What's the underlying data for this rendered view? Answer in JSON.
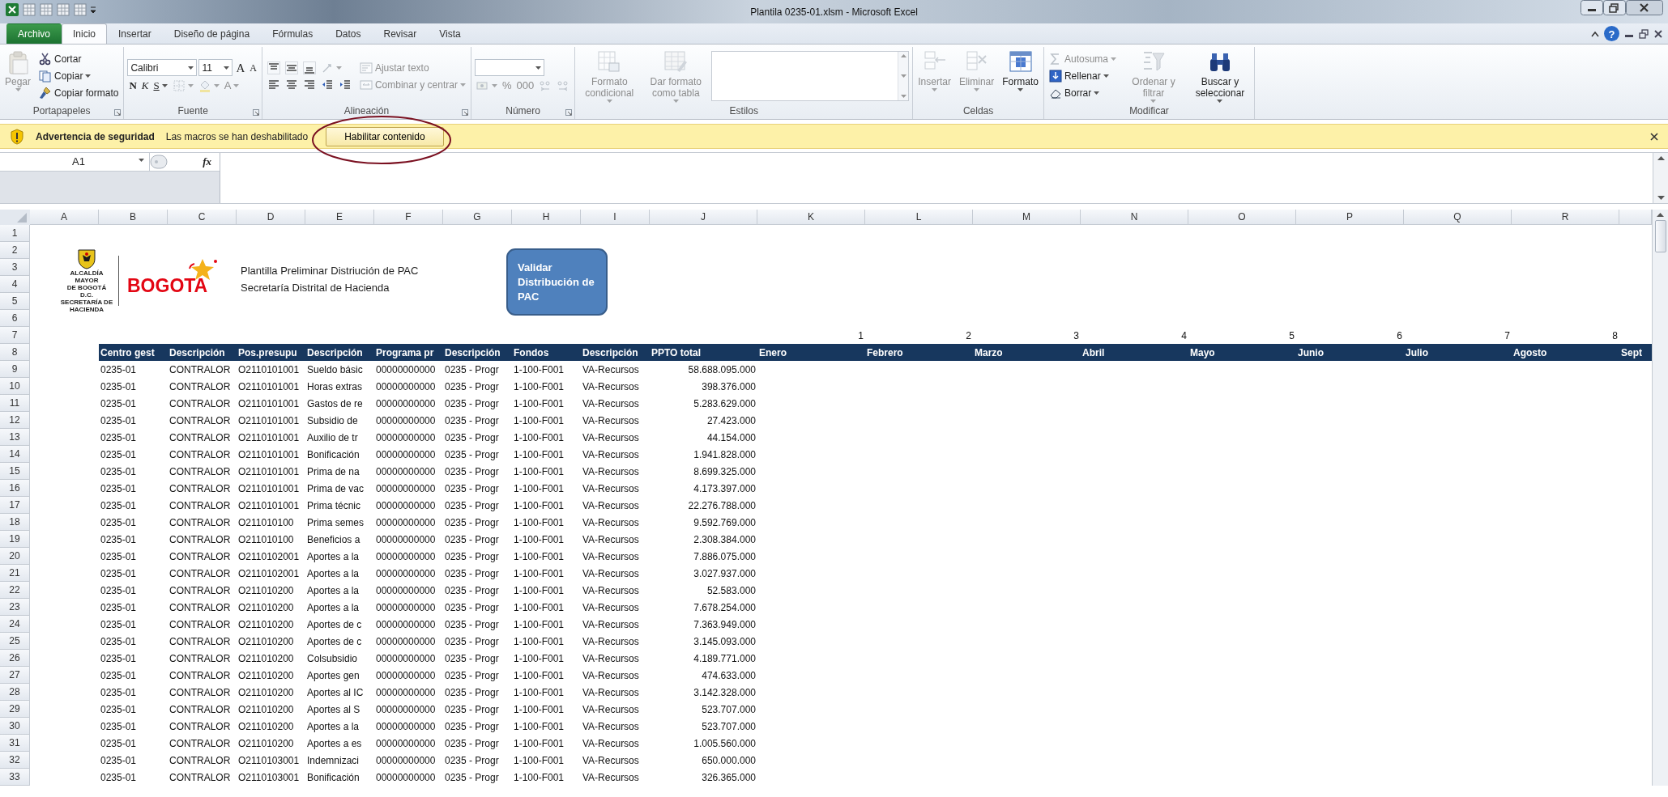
{
  "window": {
    "title": "Plantila 0235-01.xlsm  -  Microsoft Excel",
    "help": "?"
  },
  "tabs": [
    {
      "label": "Archivo",
      "kind": "file",
      "selected": false
    },
    {
      "label": "Inicio",
      "kind": "tab",
      "selected": true
    },
    {
      "label": "Insertar",
      "kind": "tab",
      "selected": false
    },
    {
      "label": "Diseño de página",
      "kind": "tab",
      "selected": false
    },
    {
      "label": "Fórmulas",
      "kind": "tab",
      "selected": false
    },
    {
      "label": "Datos",
      "kind": "tab",
      "selected": false
    },
    {
      "label": "Revisar",
      "kind": "tab",
      "selected": false
    },
    {
      "label": "Vista",
      "kind": "tab",
      "selected": false
    }
  ],
  "ribbon": [
    {
      "label": "Portapapeles",
      "launcher": true,
      "sections": [
        [
          [
            {
              "kind": "large",
              "label": "Pegar",
              "disabled": true,
              "dropdown": true
            }
          ]
        ],
        [
          [
            {
              "kind": "small",
              "label": "Cortar",
              "disabled": false
            }
          ],
          [
            {
              "kind": "small",
              "label": "Copiar",
              "disabled": false,
              "dropdown": true
            }
          ],
          [
            {
              "kind": "small",
              "label": "Copiar formato",
              "disabled": false
            }
          ]
        ]
      ]
    },
    {
      "label": "Fuente",
      "launcher": true,
      "sections": [
        [
          [
            {
              "kind": "wide-combo",
              "value": "Calibri"
            },
            {
              "kind": "combo",
              "value": "11"
            },
            {
              "kind": "grow",
              "label": "A",
              "disabled": false
            },
            {
              "kind": "shrink",
              "label": "A",
              "disabled": false
            }
          ],
          [
            {
              "kind": "bold",
              "label": "N",
              "disabled": false
            },
            {
              "kind": "italic",
              "label": "K",
              "disabled": false
            },
            {
              "kind": "underline",
              "label": "S",
              "disabled": false,
              "dropdown": true
            },
            {
              "kind": "icon",
              "disabled": true,
              "dropdown": true
            },
            {
              "kind": "icon",
              "disabled": true,
              "dropdown": true
            },
            {
              "kind": "glyph",
              "label": "A",
              "disabled": true,
              "dropdown": true
            }
          ]
        ]
      ]
    },
    {
      "label": "Alineación",
      "launcher": true,
      "sections": [
        [
          [
            {
              "kind": "icon",
              "disabled": false
            },
            {
              "kind": "icon",
              "disabled": false
            },
            {
              "kind": "icon",
              "disabled": false
            },
            {
              "kind": "icon",
              "disabled": true,
              "dropdown": true
            }
          ],
          [
            {
              "kind": "icon",
              "disabled": false
            },
            {
              "kind": "icon",
              "disabled": false
            },
            {
              "kind": "icon",
              "disabled": false
            },
            {
              "kind": "icon",
              "disabled": false
            },
            {
              "kind": "icon",
              "disabled": false
            }
          ]
        ],
        [
          [
            {
              "kind": "small",
              "label": "Ajustar texto",
              "disabled": true
            }
          ],
          [
            {
              "kind": "small",
              "label": "Combinar y centrar",
              "disabled": true,
              "dropdown": true
            }
          ]
        ]
      ]
    },
    {
      "label": "Número",
      "launcher": true,
      "sections": [
        [
          [
            {
              "kind": "wide-combo"
            }
          ],
          [
            {
              "kind": "icon",
              "disabled": true,
              "dropdown": true
            },
            {
              "kind": "glyph",
              "label": "%",
              "disabled": true
            },
            {
              "kind": "glyph",
              "label": "000",
              "disabled": true
            },
            {
              "kind": "icon",
              "disabled": true
            },
            {
              "kind": "icon",
              "disabled": true
            }
          ]
        ]
      ]
    },
    {
      "label": "Estilos",
      "launcher": false,
      "sections": [
        [
          [
            {
              "kind": "large",
              "label": "Formato condicional",
              "disabled": true,
              "dropdown": true
            }
          ]
        ],
        [
          [
            {
              "kind": "large",
              "label": "Dar formato como tabla",
              "disabled": true,
              "dropdown": true
            }
          ]
        ],
        [
          [
            {
              "kind": "gallery"
            }
          ]
        ]
      ]
    },
    {
      "label": "Celdas",
      "launcher": false,
      "sections": [
        [
          [
            {
              "kind": "large",
              "label": "Insertar",
              "disabled": true,
              "dropdown": true
            }
          ]
        ],
        [
          [
            {
              "kind": "large",
              "label": "Eliminar",
              "disabled": true,
              "dropdown": true
            }
          ]
        ],
        [
          [
            {
              "kind": "large",
              "label": "Formato",
              "disabled": false,
              "dropdown": true
            }
          ]
        ]
      ]
    },
    {
      "label": "Modificar",
      "launcher": false,
      "sections": [
        [
          [
            {
              "kind": "small",
              "label": "Autosuma",
              "disabled": true,
              "dropdown": true
            }
          ],
          [
            {
              "kind": "small",
              "label": "Rellenar",
              "disabled": false,
              "dropdown": true
            }
          ],
          [
            {
              "kind": "small",
              "label": "Borrar",
              "disabled": false,
              "dropdown": true
            }
          ]
        ],
        [
          [
            {
              "kind": "large",
              "label": "Ordenar y filtrar",
              "disabled": true,
              "dropdown": true
            }
          ]
        ],
        [
          [
            {
              "kind": "large",
              "label": "Buscar y seleccionar",
              "disabled": false,
              "dropdown": true
            }
          ]
        ]
      ]
    }
  ],
  "security_bar": {
    "title": "Advertencia de seguridad",
    "message": "Las macros se han deshabilitado",
    "button": "Habilitar contenido"
  },
  "formula_bar": {
    "name_box": "A1",
    "function_label": "fx"
  },
  "sheet": {
    "column_headers": [
      "A",
      "B",
      "C",
      "D",
      "E",
      "F",
      "G",
      "H",
      "I",
      "J",
      "K",
      "L",
      "M",
      "N",
      "O",
      "P",
      "Q",
      "R"
    ],
    "row_numbers": [
      "1",
      "2",
      "3",
      "4",
      "5",
      "6",
      "7",
      "8",
      "9",
      "10",
      "11",
      "12",
      "13",
      "14",
      "15",
      "16",
      "17",
      "18",
      "19",
      "20",
      "21",
      "22",
      "23",
      "24",
      "25",
      "26",
      "27",
      "28",
      "29",
      "30",
      "31",
      "32",
      "33"
    ],
    "logo": {
      "lines": [
        "ALCALDÍA MAYOR",
        "DE BOGOTÁ D.C.",
        "SECRETARÍA DE HACIENDA"
      ],
      "wordmark": "BOGOTA"
    },
    "title_lines": [
      "Plantilla Preliminar Distriución de PAC",
      "Secretaría Distrital de Hacienda"
    ],
    "macro_button": "Validar Distribución de PAC",
    "month_numbers": [
      "1",
      "2",
      "3",
      "4",
      "5",
      "6",
      "7",
      "8"
    ],
    "table": {
      "columns": [
        "Centro gest",
        "Descripción",
        "Pos.presupu",
        "Descripción",
        "Programa pr",
        "Descripción",
        "Fondos",
        "Descripción",
        "PPTO total",
        "Enero",
        "Febrero",
        "Marzo",
        "Abril",
        "Mayo",
        "Junio",
        "Julio",
        "Agosto",
        "Sept"
      ],
      "rows": [
        [
          "0235-01",
          "CONTRALOR",
          "O2110101001",
          "Sueldo básic",
          "00000000000",
          "0235 - Progr",
          "1-100-F001",
          "VA-Recursos",
          "58.688.095.000"
        ],
        [
          "0235-01",
          "CONTRALOR",
          "O2110101001",
          "Horas extras",
          "00000000000",
          "0235 - Progr",
          "1-100-F001",
          "VA-Recursos",
          "398.376.000"
        ],
        [
          "0235-01",
          "CONTRALOR",
          "O2110101001",
          "Gastos de re",
          "00000000000",
          "0235 - Progr",
          "1-100-F001",
          "VA-Recursos",
          "5.283.629.000"
        ],
        [
          "0235-01",
          "CONTRALOR",
          "O2110101001",
          "Subsidio de",
          "00000000000",
          "0235 - Progr",
          "1-100-F001",
          "VA-Recursos",
          "27.423.000"
        ],
        [
          "0235-01",
          "CONTRALOR",
          "O2110101001",
          "Auxilio de tr",
          "00000000000",
          "0235 - Progr",
          "1-100-F001",
          "VA-Recursos",
          "44.154.000"
        ],
        [
          "0235-01",
          "CONTRALOR",
          "O2110101001",
          "Bonificación",
          "00000000000",
          "0235 - Progr",
          "1-100-F001",
          "VA-Recursos",
          "1.941.828.000"
        ],
        [
          "0235-01",
          "CONTRALOR",
          "O2110101001",
          "Prima de na",
          "00000000000",
          "0235 - Progr",
          "1-100-F001",
          "VA-Recursos",
          "8.699.325.000"
        ],
        [
          "0235-01",
          "CONTRALOR",
          "O2110101001",
          "Prima de vac",
          "00000000000",
          "0235 - Progr",
          "1-100-F001",
          "VA-Recursos",
          "4.173.397.000"
        ],
        [
          "0235-01",
          "CONTRALOR",
          "O2110101001",
          "Prima técnic",
          "00000000000",
          "0235 - Progr",
          "1-100-F001",
          "VA-Recursos",
          "22.276.788.000"
        ],
        [
          "0235-01",
          "CONTRALOR",
          "O211010100",
          "Prima semes",
          "00000000000",
          "0235 - Progr",
          "1-100-F001",
          "VA-Recursos",
          "9.592.769.000"
        ],
        [
          "0235-01",
          "CONTRALOR",
          "O211010100",
          "Beneficios a",
          "00000000000",
          "0235 - Progr",
          "1-100-F001",
          "VA-Recursos",
          "2.308.384.000"
        ],
        [
          "0235-01",
          "CONTRALOR",
          "O2110102001",
          "Aportes a la",
          "00000000000",
          "0235 - Progr",
          "1-100-F001",
          "VA-Recursos",
          "7.886.075.000"
        ],
        [
          "0235-01",
          "CONTRALOR",
          "O2110102001",
          "Aportes a la",
          "00000000000",
          "0235 - Progr",
          "1-100-F001",
          "VA-Recursos",
          "3.027.937.000"
        ],
        [
          "0235-01",
          "CONTRALOR",
          "O211010200",
          "Aportes a la",
          "00000000000",
          "0235 - Progr",
          "1-100-F001",
          "VA-Recursos",
          "52.583.000"
        ],
        [
          "0235-01",
          "CONTRALOR",
          "O211010200",
          "Aportes a la",
          "00000000000",
          "0235 - Progr",
          "1-100-F001",
          "VA-Recursos",
          "7.678.254.000"
        ],
        [
          "0235-01",
          "CONTRALOR",
          "O211010200",
          "Aportes de c",
          "00000000000",
          "0235 - Progr",
          "1-100-F001",
          "VA-Recursos",
          "7.363.949.000"
        ],
        [
          "0235-01",
          "CONTRALOR",
          "O211010200",
          "Aportes de c",
          "00000000000",
          "0235 - Progr",
          "1-100-F001",
          "VA-Recursos",
          "3.145.093.000"
        ],
        [
          "0235-01",
          "CONTRALOR",
          "O211010200",
          "Colsubsidio",
          "00000000000",
          "0235 - Progr",
          "1-100-F001",
          "VA-Recursos",
          "4.189.771.000"
        ],
        [
          "0235-01",
          "CONTRALOR",
          "O211010200",
          "Aportes gen",
          "00000000000",
          "0235 - Progr",
          "1-100-F001",
          "VA-Recursos",
          "474.633.000"
        ],
        [
          "0235-01",
          "CONTRALOR",
          "O211010200",
          "Aportes al IC",
          "00000000000",
          "0235 - Progr",
          "1-100-F001",
          "VA-Recursos",
          "3.142.328.000"
        ],
        [
          "0235-01",
          "CONTRALOR",
          "O211010200",
          "Aportes al S",
          "00000000000",
          "0235 - Progr",
          "1-100-F001",
          "VA-Recursos",
          "523.707.000"
        ],
        [
          "0235-01",
          "CONTRALOR",
          "O211010200",
          "Aportes a la",
          "00000000000",
          "0235 - Progr",
          "1-100-F001",
          "VA-Recursos",
          "523.707.000"
        ],
        [
          "0235-01",
          "CONTRALOR",
          "O211010200",
          "Aportes a es",
          "00000000000",
          "0235 - Progr",
          "1-100-F001",
          "VA-Recursos",
          "1.005.560.000"
        ],
        [
          "0235-01",
          "CONTRALOR",
          "O2110103001",
          "Indemnizaci",
          "00000000000",
          "0235 - Progr",
          "1-100-F001",
          "VA-Recursos",
          "650.000.000"
        ],
        [
          "0235-01",
          "CONTRALOR",
          "O2110103001",
          "Bonificación",
          "00000000000",
          "0235 - Progr",
          "1-100-F001",
          "VA-Recursos",
          "326.365.000"
        ]
      ]
    }
  }
}
